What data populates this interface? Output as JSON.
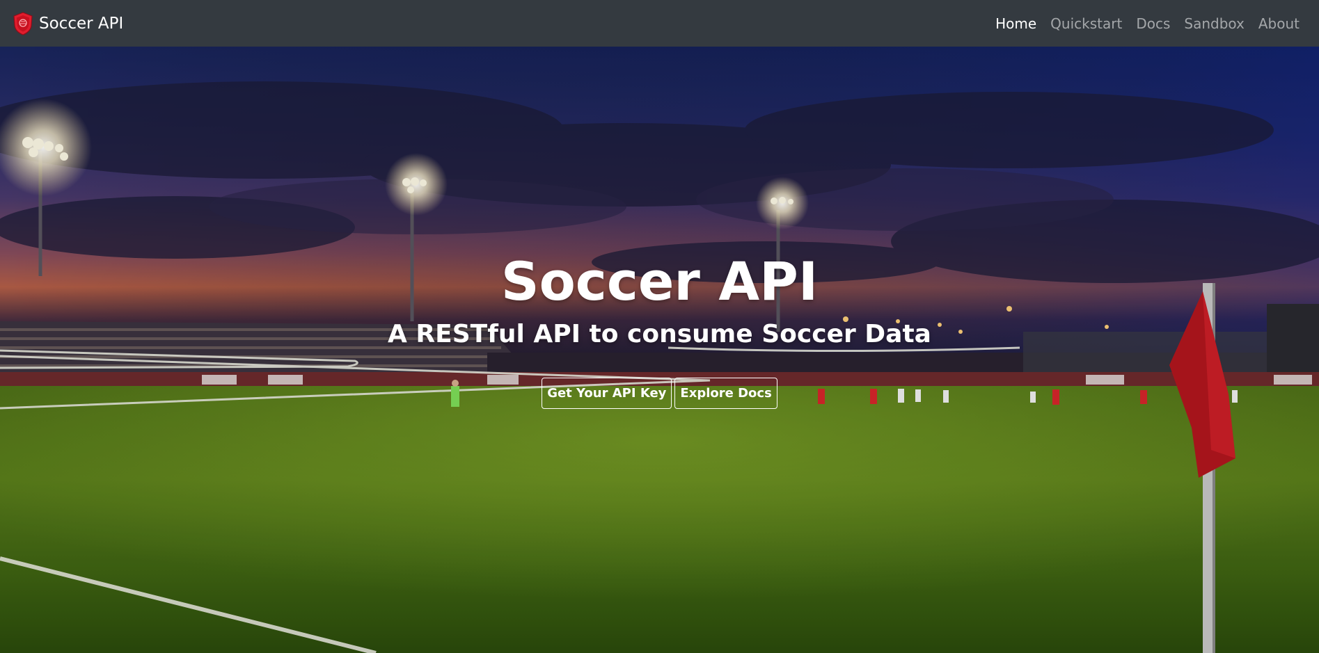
{
  "navbar": {
    "brand": "Soccer API",
    "brand_icon": "shield-logo-icon",
    "background": "#343a40",
    "links": [
      {
        "label": "Home",
        "active": true
      },
      {
        "label": "Quickstart",
        "active": false
      },
      {
        "label": "Docs",
        "active": false
      },
      {
        "label": "Sandbox",
        "active": false
      },
      {
        "label": "About",
        "active": false
      }
    ]
  },
  "hero": {
    "title": "Soccer API",
    "subtitle": "A RESTful API to consume Soccer Data",
    "buttons": {
      "api_key": "Get Your API Key",
      "docs": "Explore Docs"
    },
    "background_image": "night-soccer-stadium-photo"
  },
  "colors": {
    "navbar": "#343a40",
    "logo_red": "#e11d2e",
    "text_primary": "#ffffff"
  }
}
